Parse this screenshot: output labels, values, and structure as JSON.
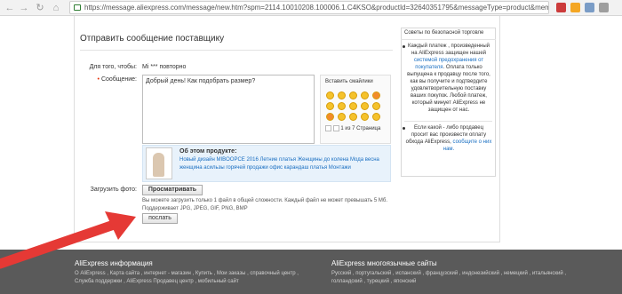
{
  "browser": {
    "url": "https://message.aliexpress.com/message/new.htm?spm=2114.10010208.100006.1.C4KSO&productId=32640351795&messageType=product&memberType=seller&refer=/a",
    "back_glyph": "←",
    "forward_glyph": "→",
    "reload_glyph": "↻",
    "home_glyph": "⌂"
  },
  "form": {
    "title": "Отправить сообщение поставщику",
    "to_label": "Для того, чтобы:",
    "to_value": "Mi *** повторно",
    "required_mark": "•",
    "message_label": "Сообщение:",
    "message_value": "Добрый день! Как подобрать размер?",
    "smileys_title": "Вставить смайлики",
    "pager_text": "1 из 7 Страница",
    "product_heading": "Об этом продукте:",
    "product_link": "Новый дизайн MIBOOPCE 2016 Летние платья Женщины до колена Мода весна женщина асильзы горячей продажи офис карандаш платья Монтажи",
    "upload_label": "Загрузить фото:",
    "browse_button": "Просматривать",
    "upload_hint": "Вы можете загрузить только 1 файл в общей сложности. Каждый файл не может превышать 5 Мб. Поддерживает JPG, JPEG, GIF, PNG, BMP",
    "send_button": "послать"
  },
  "tips": {
    "heading": "Советы по безопасной торговле",
    "tip1_a": "Каждый платеж , произведенный на AliExpress защищен нашей",
    "tip1_link": "системой предохранения от покупателя",
    "tip1_b": ". Оплата только выпущена к продавцу после того, как вы получите и подтвердите удовлетворительную поставку ваших покупок. Любой платеж, который минует AliExpress не защищен от нас.",
    "tip2_a": "Если какой - либо продавец просит вас произвести оплату обхода AliExpress,",
    "tip2_link": "сообщите о них нам."
  },
  "footer": {
    "left_heading": "AliExpress информация",
    "left_links": "О AliExpress , Карта сайта , интернет - магазин , Купить , Мои заказы , справочный центр , Служба поддержки , AliExpress Продавец центр , мобильный сайт",
    "right_heading": "AliExpress многоязычные сайты",
    "right_links": "Русский , португальский , испанский , французский , индонезийский , немецкий , итальянский , голландский , турецкий , японский"
  },
  "colors": {
    "accent_link": "#1a6fc2",
    "required": "#e62e04",
    "arrow": "#e53935",
    "footer_bg": "#5a5a5a"
  }
}
